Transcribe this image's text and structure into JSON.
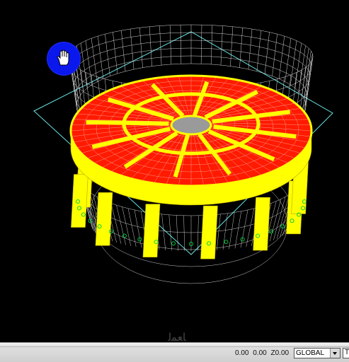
{
  "viewport": {
    "background": "#000000",
    "colors": {
      "slab": "#ff1a00",
      "beam": "#ffff00",
      "mesh": "#ffffff",
      "bounding_box": "#66e0e0",
      "column_base": "#00cc44",
      "core": "#9a9a9a"
    },
    "pan_cursor_icon": "hand-icon"
  },
  "watermark": "ﺎﻌﻤﻟ",
  "status_bar": {
    "x": "0.00",
    "y": "0.00",
    "z": "Z0.00",
    "coord_system": "GLOBAL",
    "units_box": "T"
  }
}
